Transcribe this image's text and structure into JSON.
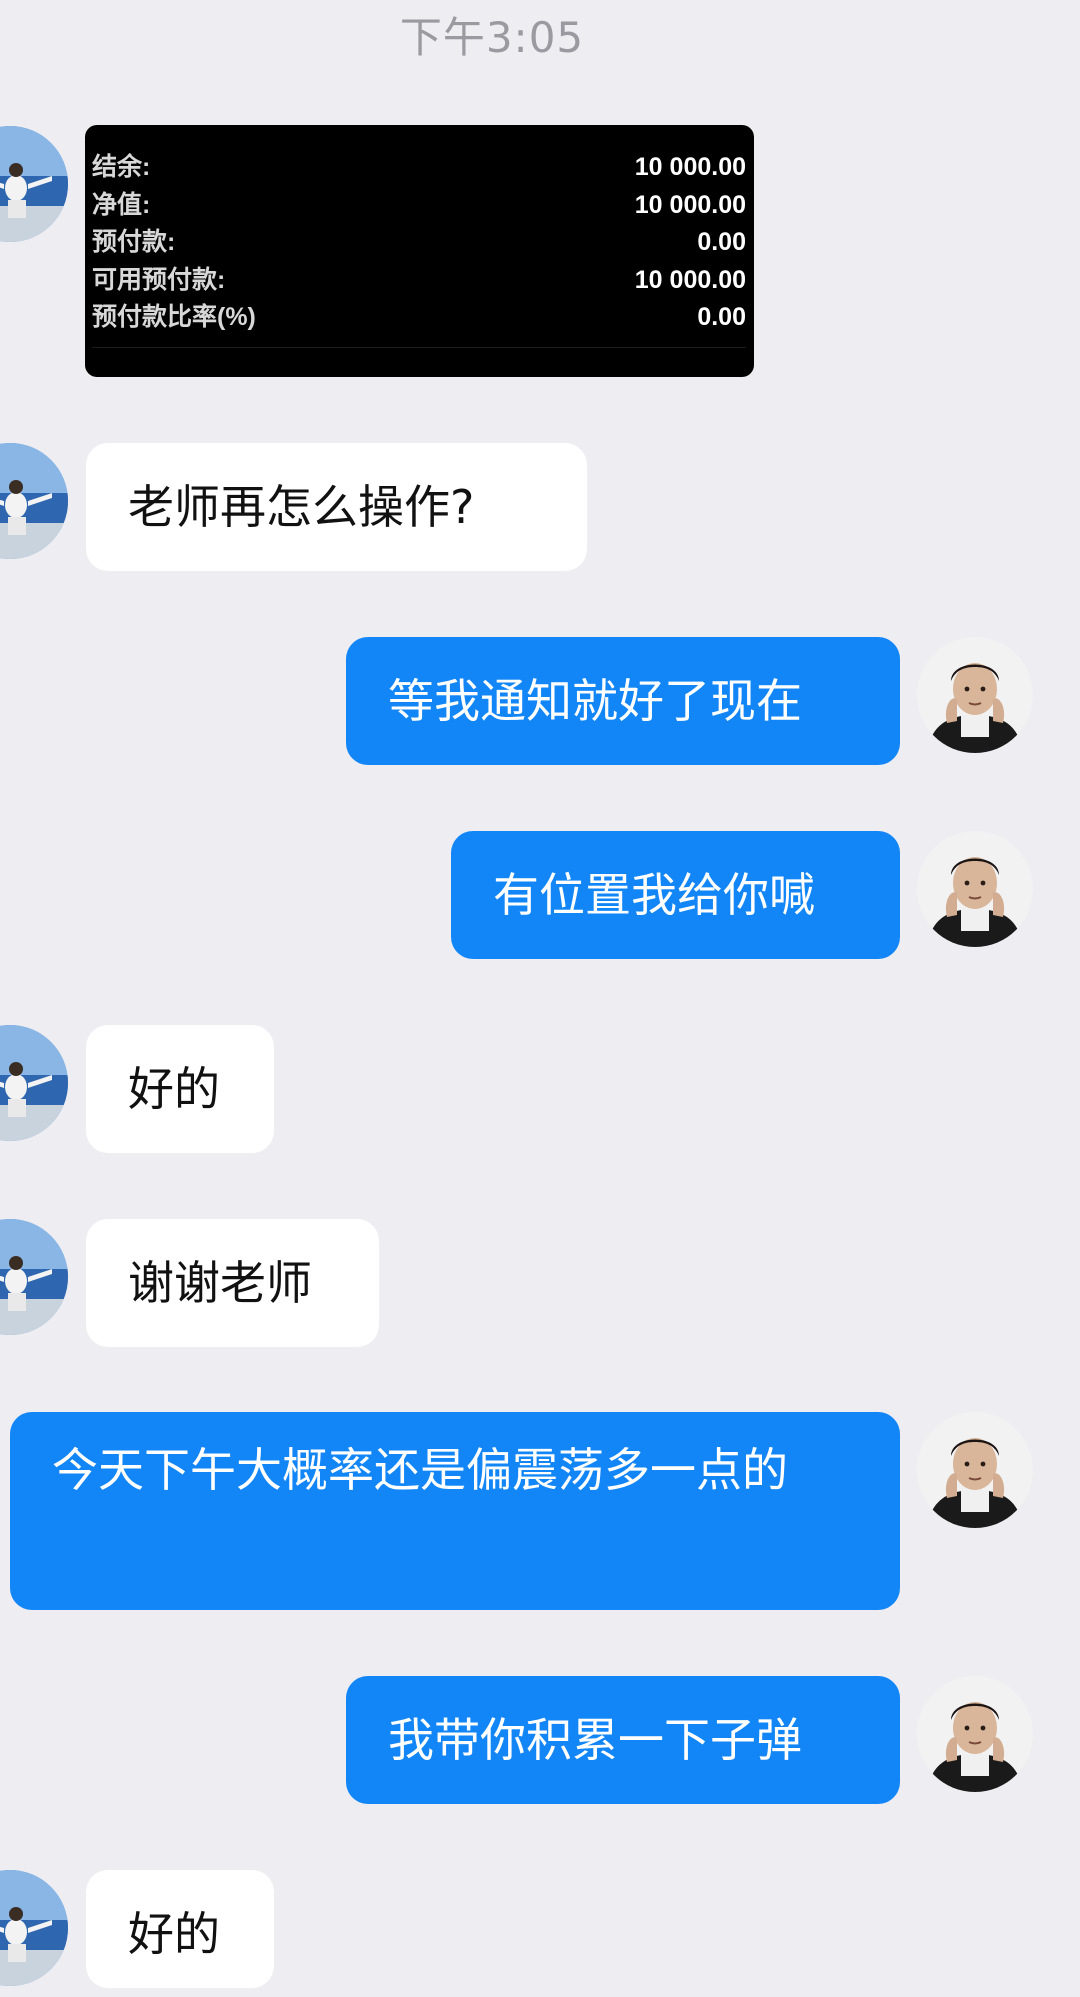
{
  "timestamp": "下午3:05",
  "account_card": {
    "rows": [
      {
        "label": "结余:",
        "value": "10 000.00"
      },
      {
        "label": "净值:",
        "value": "10 000.00"
      },
      {
        "label": "预付款:",
        "value": "0.00"
      },
      {
        "label": "可用预付款:",
        "value": "10 000.00"
      },
      {
        "label": "预付款比率(%)",
        "value": "0.00"
      }
    ]
  },
  "messages": [
    {
      "direction": "in",
      "text": "老师再怎么操作?"
    },
    {
      "direction": "out",
      "text": "等我通知就好了现在"
    },
    {
      "direction": "out",
      "text": "有位置我给你喊"
    },
    {
      "direction": "in",
      "text": "好的"
    },
    {
      "direction": "in",
      "text": "谢谢老师"
    },
    {
      "direction": "out",
      "text": "今天下午大概率还是偏震荡多一点的"
    },
    {
      "direction": "out",
      "text": "我带你积累一下子弹"
    },
    {
      "direction": "in",
      "text": "好的"
    }
  ],
  "icons": {
    "incoming_avatar": "user-avatar-beach",
    "outgoing_avatar": "user-avatar-man"
  },
  "colors": {
    "background": "#ededf2",
    "outgoing_bubble": "#1286f6",
    "incoming_bubble": "#ffffff",
    "account_card": "#000000"
  }
}
